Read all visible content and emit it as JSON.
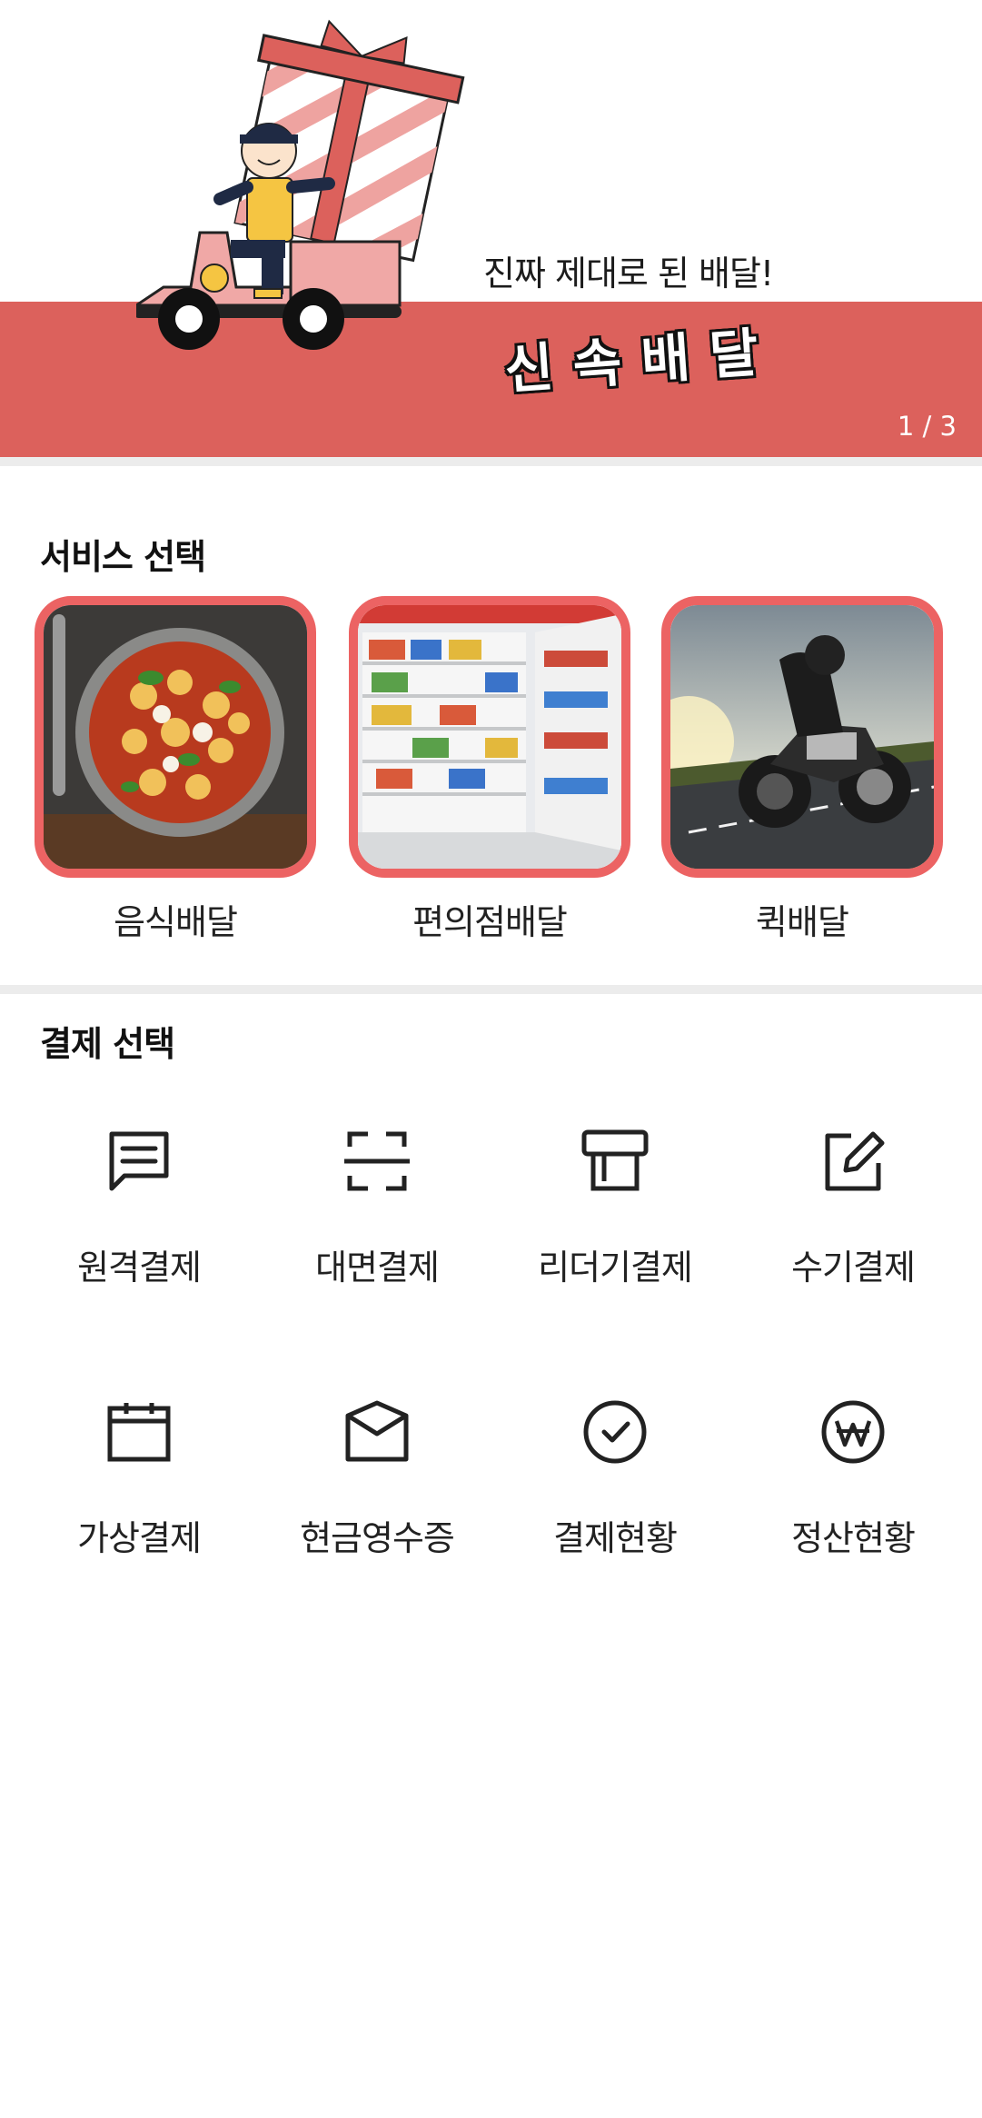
{
  "banner": {
    "tagline": "진짜 제대로 된 배달!",
    "title": "신속배달",
    "pager": "1 / 3",
    "colors": {
      "band": "#dc615c",
      "accent": "#ec6363"
    }
  },
  "services": {
    "title": "서비스 선택",
    "items": [
      {
        "label": "음식배달",
        "image": "food-image"
      },
      {
        "label": "편의점배달",
        "image": "convenience-store-image"
      },
      {
        "label": "퀵배달",
        "image": "motorcycle-image"
      }
    ]
  },
  "payments": {
    "title": "결제 선택",
    "items": [
      {
        "label": "원격결제",
        "icon": "message-icon"
      },
      {
        "label": "대면결제",
        "icon": "scan-icon"
      },
      {
        "label": "리더기결제",
        "icon": "card-reader-icon"
      },
      {
        "label": "수기결제",
        "icon": "edit-icon"
      },
      {
        "label": "가상결제",
        "icon": "calendar-icon"
      },
      {
        "label": "현금영수증",
        "icon": "envelope-icon"
      },
      {
        "label": "결제현황",
        "icon": "check-circle-icon"
      },
      {
        "label": "정산현황",
        "icon": "won-circle-icon"
      }
    ]
  }
}
